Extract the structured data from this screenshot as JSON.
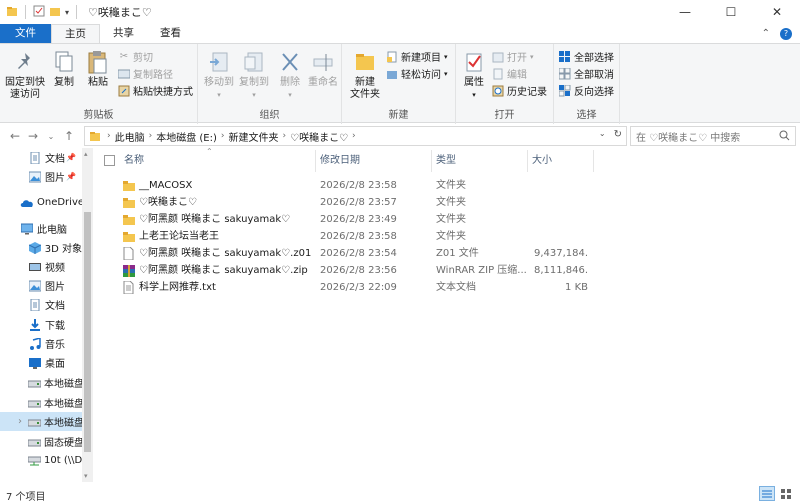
{
  "window": {
    "title": "♡咲龝まこ♡",
    "controls": {
      "minimize": "—",
      "maximize": "☐",
      "close": "✕"
    }
  },
  "ribbon_tabs": {
    "file": "文件",
    "home": "主页",
    "share": "共享",
    "view": "查看"
  },
  "ribbon": {
    "clipboard": {
      "label": "剪贴板",
      "pin_quick": "固定到快\n速访问",
      "copy": "复制",
      "paste": "粘贴",
      "cut": "剪切",
      "copy_path": "复制路径",
      "paste_shortcut": "粘贴快捷方式"
    },
    "organize": {
      "label": "组织",
      "move_to": "移动到",
      "copy_to": "复制到",
      "delete": "删除",
      "rename": "重命名"
    },
    "new": {
      "label": "新建",
      "new_folder": "新建\n文件夹",
      "new_item": "新建项目",
      "easy_access": "轻松访问"
    },
    "open": {
      "label": "打开",
      "properties": "属性",
      "open": "打开",
      "edit": "编辑",
      "history": "历史记录"
    },
    "select": {
      "label": "选择",
      "select_all": "全部选择",
      "select_none": "全部取消",
      "invert": "反向选择"
    }
  },
  "address": {
    "crumbs": [
      "此电脑",
      "本地磁盘 (E:)",
      "新建文件夹",
      "♡咲龝まこ♡"
    ],
    "search_placeholder": "在 ♡咲龝まこ♡ 中搜索"
  },
  "sidebar": {
    "items": [
      {
        "label": "文档",
        "icon": "document-icon",
        "pinned": true
      },
      {
        "label": "图片",
        "icon": "picture-icon",
        "pinned": true
      },
      {
        "label": "OneDrive",
        "icon": "cloud-icon"
      },
      {
        "label": "此电脑",
        "icon": "computer-icon"
      },
      {
        "label": "3D 对象",
        "icon": "cube-icon"
      },
      {
        "label": "视频",
        "icon": "video-icon"
      },
      {
        "label": "图片",
        "icon": "picture-icon"
      },
      {
        "label": "文档",
        "icon": "document-icon"
      },
      {
        "label": "下载",
        "icon": "download-icon"
      },
      {
        "label": "音乐",
        "icon": "music-icon"
      },
      {
        "label": "桌面",
        "icon": "desktop-icon"
      },
      {
        "label": "本地磁盘",
        "icon": "drive-icon"
      },
      {
        "label": "本地磁盘",
        "icon": "drive-icon"
      },
      {
        "label": "本地磁盘",
        "icon": "drive-icon",
        "selected": true
      },
      {
        "label": "固态硬盘",
        "icon": "drive-icon"
      },
      {
        "label": "10t (\\\\D:",
        "icon": "network-drive-icon"
      }
    ]
  },
  "columns": {
    "name": "名称",
    "date": "修改日期",
    "type": "类型",
    "size": "大小"
  },
  "files": [
    {
      "name": "__MACOSX",
      "date": "2026/2/8 23:58",
      "type": "文件夹",
      "size": "",
      "icon": "folder-icon"
    },
    {
      "name": "♡咲龝まこ♡",
      "date": "2026/2/8 23:57",
      "type": "文件夹",
      "size": "",
      "icon": "folder-icon"
    },
    {
      "name": "♡阿黑颜 咲龝まこ sakuyamak♡",
      "date": "2026/2/8 23:49",
      "type": "文件夹",
      "size": "",
      "icon": "folder-icon"
    },
    {
      "name": "上老王论坛当老王",
      "date": "2026/2/8 23:58",
      "type": "文件夹",
      "size": "",
      "icon": "folder-icon"
    },
    {
      "name": "♡阿黑颜 咲龝まこ sakuyamak♡.z01",
      "date": "2026/2/8 23:54",
      "type": "Z01 文件",
      "size": "9,437,184...",
      "icon": "file-icon"
    },
    {
      "name": "♡阿黑颜 咲龝まこ sakuyamak♡.zip",
      "date": "2026/2/8 23:56",
      "type": "WinRAR ZIP 压缩...",
      "size": "8,111,846...",
      "icon": "winrar-icon"
    },
    {
      "name": "科学上网推荐.txt",
      "date": "2026/2/3 22:09",
      "type": "文本文档",
      "size": "1 KB",
      "icon": "text-file-icon"
    }
  ],
  "status": {
    "count": "7 个项目"
  }
}
